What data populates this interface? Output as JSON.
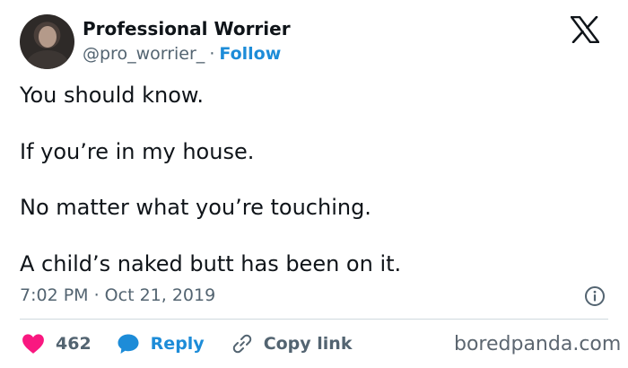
{
  "author": {
    "display_name": "Professional Worrier",
    "handle": "@pro_worrier_",
    "separator": "·",
    "follow_label": "Follow"
  },
  "tweet": {
    "lines": [
      "You should know.",
      "If you’re in my house.",
      "No matter what you’re touching.",
      "A child’s naked butt has been on it."
    ],
    "timestamp": "7:02 PM · Oct 21, 2019"
  },
  "actions": {
    "like_count": "462",
    "reply_label": "Reply",
    "copy_label": "Copy link"
  },
  "watermark": "boredpanda.com",
  "colors": {
    "accent": "#1d8cd8",
    "heart": "#f91880",
    "text": "#0f1419",
    "muted": "#536471"
  },
  "icons": [
    "x-logo-icon",
    "info-icon",
    "heart-icon",
    "reply-bubble-icon",
    "link-icon"
  ]
}
